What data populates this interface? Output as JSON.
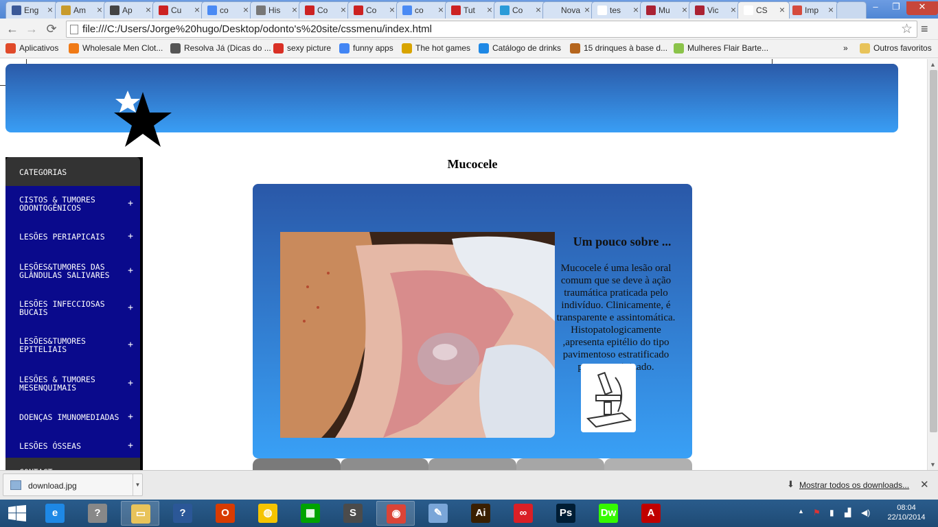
{
  "browser": {
    "tabs": [
      {
        "label": "Eng",
        "color": "#3b5998"
      },
      {
        "label": "Am",
        "color": "#c89b2c"
      },
      {
        "label": "Ap",
        "color": "#444444"
      },
      {
        "label": "Cu",
        "color": "#cc2222"
      },
      {
        "label": "co",
        "color": "#4a8af4"
      },
      {
        "label": "His",
        "color": "#777777"
      },
      {
        "label": "Co",
        "color": "#cc2222"
      },
      {
        "label": "Co",
        "color": "#cc2222"
      },
      {
        "label": "co",
        "color": "#4a8af4"
      },
      {
        "label": "Tut",
        "color": "#cc2222"
      },
      {
        "label": "Co",
        "color": "#2a9bd8"
      },
      {
        "label": "Nova",
        "color": "#d5e2f4"
      },
      {
        "label": "tes",
        "color": "#ffffff"
      },
      {
        "label": "Mu",
        "color": "#aa2233"
      },
      {
        "label": "Vic",
        "color": "#aa2233"
      },
      {
        "label": "CS",
        "color": "#ffffff"
      },
      {
        "label": "Imp",
        "color": "#d54b3d"
      }
    ],
    "url": "file:///C:/Users/Jorge%20hugo/Desktop/odonto's%20site/cssmenu/index.html",
    "window_controls": {
      "minimize": "–",
      "maximize": "❐",
      "close": "✕"
    },
    "bookmarks": [
      {
        "label": "Aplicativos",
        "color": "#e04a2a"
      },
      {
        "label": "Wholesale Men Clot...",
        "color": "#f07a16"
      },
      {
        "label": "Resolva Já (Dicas do ...",
        "color": "#555555"
      },
      {
        "label": "sexy picture",
        "color": "#d93025"
      },
      {
        "label": "funny apps",
        "color": "#4285f4"
      },
      {
        "label": "The hot games",
        "color": "#d8a400"
      },
      {
        "label": "Catálogo de drinks",
        "color": "#1e88e5"
      },
      {
        "label": "15 drinques à base d...",
        "color": "#b5651d"
      },
      {
        "label": "Mulheres Flair Barte...",
        "color": "#8bc34a"
      }
    ],
    "bookmarks_overflow": "»",
    "other_bookmarks": "Outros favoritos"
  },
  "page": {
    "sidebar": {
      "header": "CATEGORIAS",
      "items": [
        "CISTOS & TUMORES ODONTOGÊNICOS",
        "LESÕES PERIAPICAIS",
        "LESÕES&TUMORES DAS GLÂNDULAS SALIVARES",
        "LESÕES INFECCIOSAS BUCAIS",
        "LESÕES&TUMORES EPITELIAIS",
        "LESÕES & TUMORES MESENQUIMAIS",
        "DOENÇAS IMUNOMEDIADAS",
        "LESÕES ÓSSEAS"
      ],
      "plus": "+",
      "contact": "CONTACT"
    },
    "title": "Mucocele",
    "about_heading": "Um pouco sobre ...",
    "about_text": "Mucocele é uma lesão oral comum que se deve à ação traumática praticada pelo indivíduo. Clinicamente, é transparente e assintomática. Histopatologicamente ,apresenta epitélio do tipo pavimentoso estratificado paraqueratinizado."
  },
  "downloads": {
    "file": "download.jpg",
    "show_all": "Mostrar todos os downloads...",
    "close": "✕"
  },
  "taskbar": {
    "time": "08:04",
    "date": "22/10/2014",
    "apps": [
      {
        "icon": "internet-explorer-icon",
        "glyph": "e",
        "color": "#1e88e5"
      },
      {
        "icon": "help-app-icon",
        "glyph": "?",
        "color": "#888888"
      },
      {
        "icon": "file-explorer-icon",
        "glyph": "▭",
        "color": "#e8c35a"
      },
      {
        "icon": "help-icon",
        "glyph": "?",
        "color": "#2b5797"
      },
      {
        "icon": "office-icon",
        "glyph": "O",
        "color": "#d83b01"
      },
      {
        "icon": "globe-app-icon",
        "glyph": "◍",
        "color": "#f5c400"
      },
      {
        "icon": "store-icon",
        "glyph": "▦",
        "color": "#00a300"
      },
      {
        "icon": "sublime-text-icon",
        "glyph": "S",
        "color": "#4b4b4b"
      },
      {
        "icon": "chrome-icon",
        "glyph": "◉",
        "color": "#db4437"
      },
      {
        "icon": "paint-icon",
        "glyph": "✎",
        "color": "#7aa6d8"
      },
      {
        "icon": "illustrator-icon",
        "glyph": "Ai",
        "color": "#3a1f00"
      },
      {
        "icon": "creative-cloud-icon",
        "glyph": "∞",
        "color": "#da1f26"
      },
      {
        "icon": "photoshop-icon",
        "glyph": "Ps",
        "color": "#001d34"
      },
      {
        "icon": "dreamweaver-icon",
        "glyph": "Dw",
        "color": "#35fa00"
      },
      {
        "icon": "acrobat-icon",
        "glyph": "A",
        "color": "#c00000"
      }
    ]
  },
  "colors": {
    "header_top": "#2b5aa8",
    "header_bottom": "#399ef5",
    "sidebar_item": "#0a0a8c",
    "sidebar_header": "#333333"
  }
}
